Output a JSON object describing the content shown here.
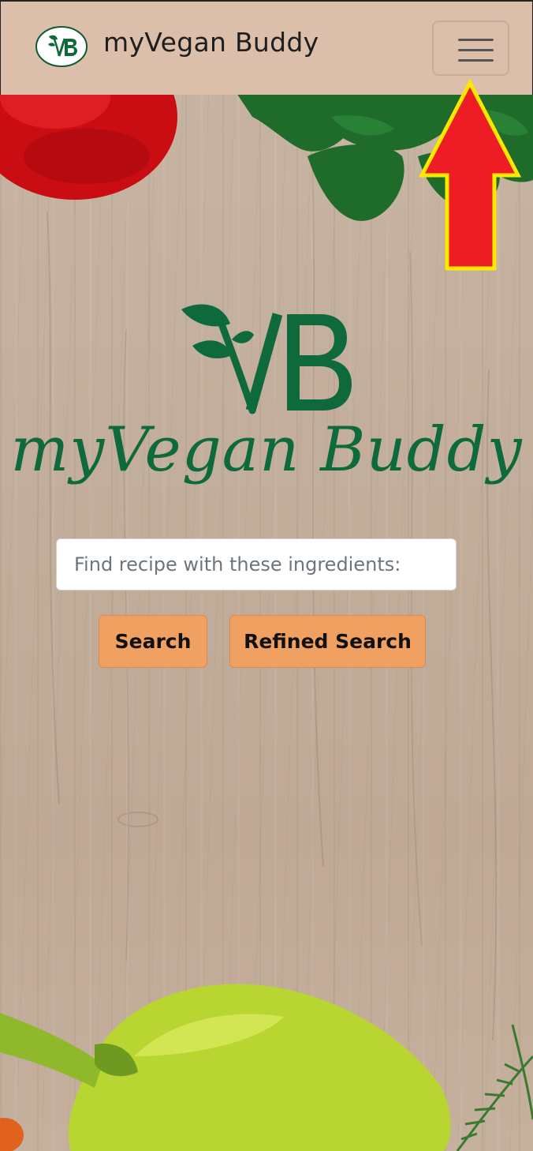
{
  "app": {
    "brand_name": "myVegan Buddy",
    "logo_initials": "VB",
    "hero_title": "myVegan Buddy"
  },
  "search": {
    "placeholder": "Find recipe with these ingredients:",
    "value": "",
    "search_label": "Search",
    "refined_label": "Refined Search"
  },
  "icons": {
    "menu": "hamburger-menu-icon",
    "logo": "leaf-vb-logo-icon",
    "annotation": "red-up-arrow-icon"
  },
  "colors": {
    "navbar_bg": "#dbbfab",
    "brand_green": "#0e6a3a",
    "button_bg": "#f0a060",
    "arrow_fill": "#ee1c25",
    "arrow_stroke": "#ffe800"
  }
}
